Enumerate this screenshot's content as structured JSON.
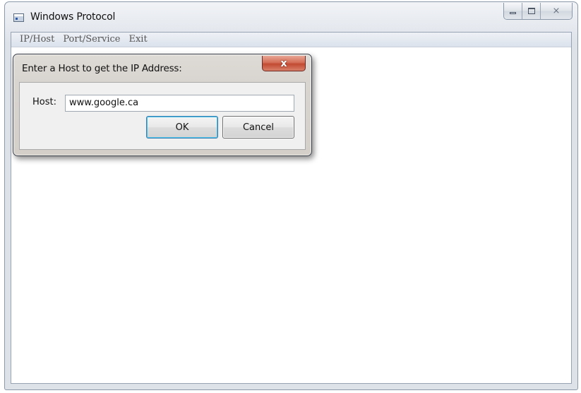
{
  "window": {
    "title": "Windows Protocol",
    "controls": {
      "minimize_icon": "minimize-icon",
      "maximize_icon": "maximize-icon",
      "close_glyph": "⨯"
    }
  },
  "menubar": {
    "items": [
      {
        "label": "IP/Host"
      },
      {
        "label": "Port/Service"
      },
      {
        "label": "Exit"
      }
    ]
  },
  "dialog": {
    "title": "Enter a Host to get the IP Address:",
    "close_glyph": "x",
    "host_label": "Host:",
    "host_value": "www.google.ca",
    "ok_label": "OK",
    "cancel_label": "Cancel"
  },
  "colors": {
    "dialog_close_red": "#c94b33",
    "focus_blue": "#48bfe8"
  }
}
